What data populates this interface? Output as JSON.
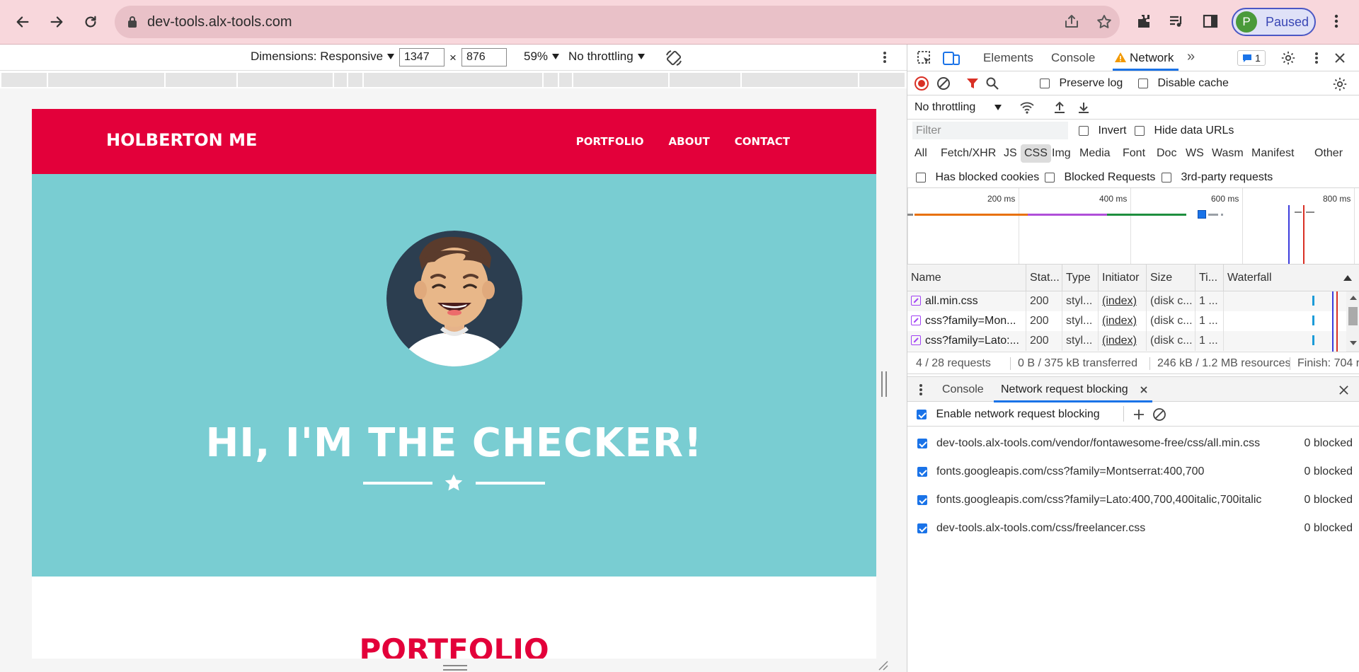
{
  "browser": {
    "url": "dev-tools.alx-tools.com",
    "profile_initial": "P",
    "profile_label": "Paused"
  },
  "device_toolbar": {
    "dimensions_label": "Dimensions: Responsive",
    "width": "1347",
    "times": "×",
    "height": "876",
    "zoom": "59%",
    "throttling": "No throttling"
  },
  "site": {
    "brand": "HOLBERTON ME",
    "nav": [
      "PORTFOLIO",
      "ABOUT",
      "CONTACT"
    ],
    "headline": "HI, I'M THE CHECKER!",
    "section_title": "PORTFOLIO",
    "colors": {
      "primary": "#e3003a",
      "hero": "#79cdd2"
    }
  },
  "devtools": {
    "tabs": [
      "Elements",
      "Console",
      "Network"
    ],
    "active_tab": "Network",
    "issues_count": "1",
    "toolbar": {
      "preserve_log": "Preserve log",
      "disable_cache": "Disable cache",
      "throttling": "No throttling"
    },
    "filter": {
      "placeholder": "Filter",
      "invert": "Invert",
      "hide_data_urls": "Hide data URLs"
    },
    "types": [
      "All",
      "Fetch/XHR",
      "JS",
      "CSS",
      "Img",
      "Media",
      "Font",
      "Doc",
      "WS",
      "Wasm",
      "Manifest",
      "Other"
    ],
    "active_type": "CSS",
    "checks": [
      "Has blocked cookies",
      "Blocked Requests",
      "3rd-party requests"
    ],
    "timeline_ticks": [
      "200 ms",
      "400 ms",
      "600 ms",
      "800 ms"
    ],
    "columns": [
      "Name",
      "Stat...",
      "Type",
      "Initiator",
      "Size",
      "Ti...",
      "Waterfall"
    ],
    "rows": [
      {
        "name": "all.min.css",
        "status": "200",
        "type": "styl...",
        "initiator": "(index)",
        "size": "(disk c...",
        "time": "1 ..."
      },
      {
        "name": "css?family=Mon...",
        "status": "200",
        "type": "styl...",
        "initiator": "(index)",
        "size": "(disk c...",
        "time": "1 ..."
      },
      {
        "name": "css?family=Lato:...",
        "status": "200",
        "type": "styl...",
        "initiator": "(index)",
        "size": "(disk c...",
        "time": "1 ..."
      }
    ],
    "summary": {
      "requests": "4 / 28 requests",
      "transferred": "0 B / 375 kB transferred",
      "resources": "246 kB / 1.2 MB resources",
      "finish": "Finish: 704 r"
    },
    "drawer": {
      "tabs": [
        "Console",
        "Network request blocking"
      ],
      "enable_label": "Enable network request blocking",
      "patterns": [
        {
          "url": "dev-tools.alx-tools.com/vendor/fontawesome-free/css/all.min.css",
          "status": "0 blocked"
        },
        {
          "url": "fonts.googleapis.com/css?family=Montserrat:400,700",
          "status": "0 blocked"
        },
        {
          "url": "fonts.googleapis.com/css?family=Lato:400,700,400italic,700italic",
          "status": "0 blocked"
        },
        {
          "url": "dev-tools.alx-tools.com/css/freelancer.css",
          "status": "0 blocked"
        }
      ]
    }
  }
}
